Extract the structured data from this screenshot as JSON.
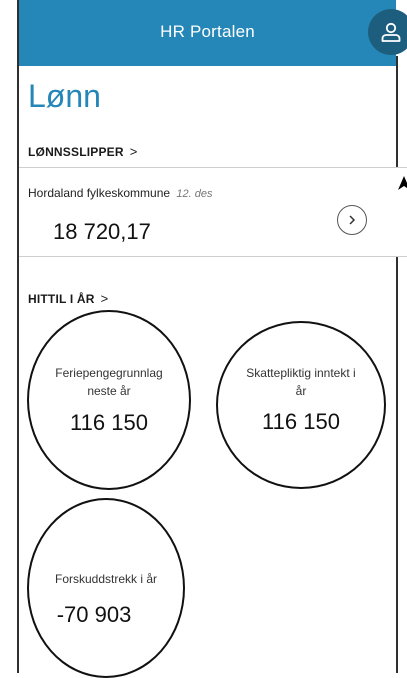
{
  "header": {
    "title": "HR Portalen",
    "profile_icon": "user-icon",
    "color": "#2587b8"
  },
  "page": {
    "title": "Lønn"
  },
  "payslips": {
    "section_label": "LØNNSSLIPPER",
    "chevron": ">",
    "item": {
      "employer": "Hordaland fylkeskommune",
      "date": "12. des",
      "amount": "18 720,17",
      "open_icon": "chevron-right-icon"
    }
  },
  "year_to_date": {
    "section_label": "HITTIL I ÅR",
    "chevron": ">",
    "items": [
      {
        "label_line1": "Feriepengegrunnlag",
        "label_line2": "neste år",
        "value": "116 150"
      },
      {
        "label_line1": "Skattepliktig inntekt i",
        "label_line2": "år",
        "value": "116 150"
      },
      {
        "label_line1": "Forskuddstrekk i år",
        "label_line2": "",
        "value": "-70 903"
      }
    ]
  }
}
